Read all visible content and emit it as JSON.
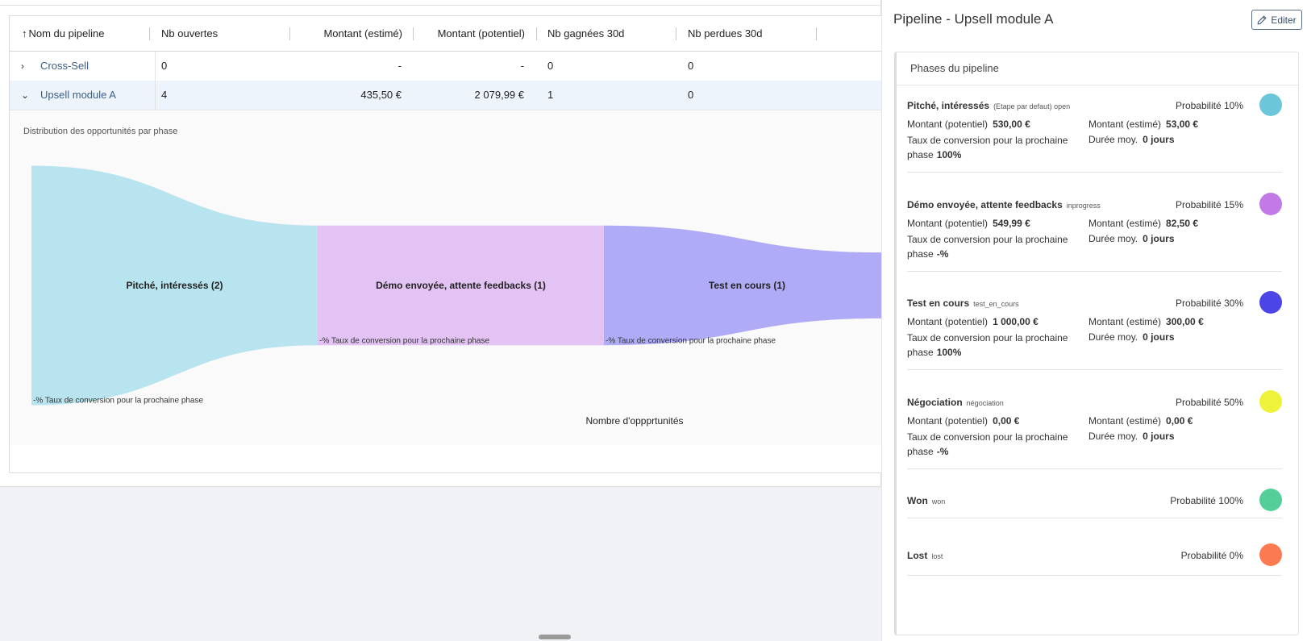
{
  "table": {
    "headers": [
      {
        "label": "Nom du pipeline",
        "sort": "↑"
      },
      {
        "label": "Nb ouvertes"
      },
      {
        "label": "Montant (estimé)"
      },
      {
        "label": "Montant (potentiel)"
      },
      {
        "label": "Nb gagnées 30d"
      },
      {
        "label": "Nb perdues 30d"
      }
    ],
    "rows": [
      {
        "chevron": "›",
        "name": "Cross-Sell",
        "open": "0",
        "estimated": "-",
        "potential": "-",
        "won30": "0",
        "lost30": "0"
      },
      {
        "chevron": "⌄",
        "name": "Upsell module A",
        "open": "4",
        "estimated": "435,50 €",
        "potential": "2 079,99 €",
        "won30": "1",
        "lost30": "0"
      }
    ]
  },
  "distribution": {
    "title": "Distribution des opportunités par phase",
    "axis_label": "Nombre d'oppprtunités"
  },
  "chart_data": {
    "type": "sankey",
    "stages": [
      {
        "label": "Pitché, intéressés (2)",
        "value": 2,
        "color": "#b7e4ee",
        "conversion": "-% Taux de conversion pour la prochaine phase"
      },
      {
        "label": "Démo envoyée, attente feedbacks (1)",
        "value": 1,
        "color": "#e2c3f3",
        "conversion": "-% Taux de conversion pour la prochaine phase"
      },
      {
        "label": "Test en cours (1)",
        "value": 1,
        "color": "#afabf7",
        "conversion": "-% Taux de conversion pour la prochaine phase"
      }
    ],
    "xlabel": "Nombre d'oppprtunités"
  },
  "side": {
    "title": "Pipeline - Upsell module A",
    "edit_label": "Editer",
    "edit_icon": "pencil-icon",
    "card_title": "Phases du pipeline",
    "phases": [
      {
        "name": "Pitché, intéressés",
        "tag": "(Etape par defaut) open",
        "probability": "Probabilité 10%",
        "color": "#6cc6d9",
        "potential_label": "Montant (potentiel)",
        "potential": "530,00 €",
        "estimated_label": "Montant (estimé)",
        "estimated": "53,00 €",
        "conversion_label": "Taux de conversion pour la prochaine phase",
        "conversion": "100%",
        "duration_label": "Durée moy.",
        "duration": "0 jours"
      },
      {
        "name": "Démo envoyée, attente feedbacks",
        "tag": "inprogress",
        "probability": "Probabilité 15%",
        "color": "#c27ae6",
        "potential_label": "Montant (potentiel)",
        "potential": "549,99 €",
        "estimated_label": "Montant (estimé)",
        "estimated": "82,50 €",
        "conversion_label": "Taux de conversion pour la prochaine phase",
        "conversion": "-%",
        "duration_label": "Durée moy.",
        "duration": "0 jours"
      },
      {
        "name": "Test en cours",
        "tag": "test_en_cours",
        "probability": "Probabilité 30%",
        "color": "#4b45e8",
        "potential_label": "Montant (potentiel)",
        "potential": "1 000,00 €",
        "estimated_label": "Montant (estimé)",
        "estimated": "300,00 €",
        "conversion_label": "Taux de conversion pour la prochaine phase",
        "conversion": "100%",
        "duration_label": "Durée moy.",
        "duration": "0 jours"
      },
      {
        "name": "Négociation",
        "tag": "négociation",
        "probability": "Probabilité 50%",
        "color": "#eef23a",
        "potential_label": "Montant (potentiel)",
        "potential": "0,00 €",
        "estimated_label": "Montant (estimé)",
        "estimated": "0,00 €",
        "conversion_label": "Taux de conversion pour la prochaine phase",
        "conversion": "-%",
        "duration_label": "Durée moy.",
        "duration": "0 jours"
      },
      {
        "name": "Won",
        "tag": "won",
        "probability": "Probabilité 100%",
        "color": "#55cf99"
      },
      {
        "name": "Lost",
        "tag": "lost",
        "probability": "Probabilité 0%",
        "color": "#fb7a50"
      }
    ]
  }
}
